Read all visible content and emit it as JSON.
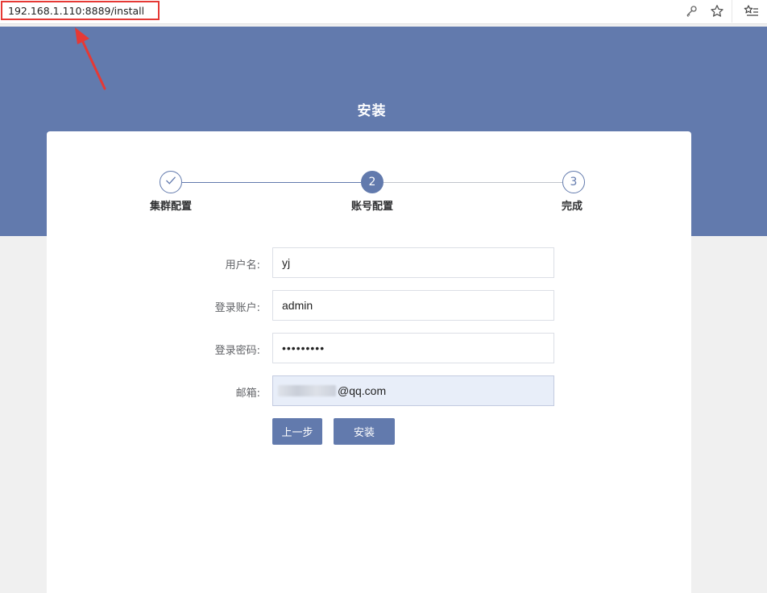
{
  "browser": {
    "url": "192.168.1.110:8889/install",
    "icons": [
      "key-icon",
      "star-icon",
      "favorites-list-icon"
    ]
  },
  "page": {
    "title": "安装"
  },
  "steps": [
    {
      "label": "集群配置",
      "status": "done",
      "marker": "check-icon"
    },
    {
      "label": "账号配置",
      "status": "active",
      "number": "2"
    },
    {
      "label": "完成",
      "status": "pending",
      "number": "3"
    }
  ],
  "form": {
    "username": {
      "label": "用户名:",
      "value": "yj"
    },
    "account": {
      "label": "登录账户:",
      "value": "admin"
    },
    "password": {
      "label": "登录密码:",
      "value": "•••••••••"
    },
    "email": {
      "label": "邮箱:",
      "value": "@qq.com"
    }
  },
  "buttons": {
    "prev": "上一步",
    "install": "安装"
  },
  "colors": {
    "primary": "#627aad",
    "annotation": "#e53935",
    "background": "#f0f0f0"
  }
}
